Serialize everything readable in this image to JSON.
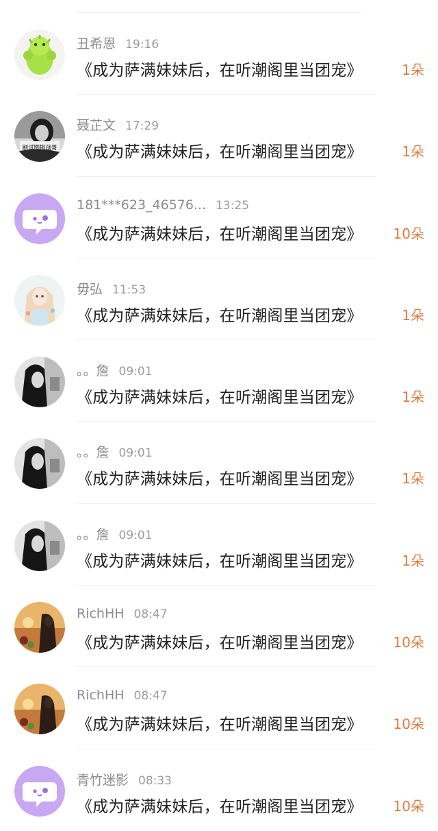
{
  "colors": {
    "accent": "#e07a3c",
    "name": "#8c8c8c",
    "time": "#9c9c9c",
    "title": "#222222",
    "divider": "#efefef",
    "default_avatar": "#c9a8f3"
  },
  "records": [
    {
      "name": "丑希恩",
      "time": "19:16",
      "title": "《成为萨满妹妹后，在听潮阁里当团宠》",
      "count": "1朵",
      "avatar": "green-figure-avatar"
    },
    {
      "name": "聂芷文",
      "time": "17:29",
      "title": "《成为萨满妹妹后，在听潮阁里当团宠》",
      "count": "1朵",
      "avatar": "bw-photo-avatar",
      "avatar_caption": "刷试图挑战哥"
    },
    {
      "name": "181***623_46576...",
      "time": "13:25",
      "title": "《成为萨满妹妹后，在听潮阁里当团宠》",
      "count": "10朵",
      "avatar": "default-chat-avatar"
    },
    {
      "name": "毋弘",
      "time": "11:53",
      "title": "《成为萨满妹妹后，在听潮阁里当团宠》",
      "count": "1朵",
      "avatar": "anime-girl-avatar"
    },
    {
      "name": "。。詹",
      "time": "09:01",
      "title": "《成为萨满妹妹后，在听潮阁里当团宠》",
      "count": "1朵",
      "avatar": "bw-girl-avatar"
    },
    {
      "name": "。。詹",
      "time": "09:01",
      "title": "《成为萨满妹妹后，在听潮阁里当团宠》",
      "count": "1朵",
      "avatar": "bw-girl-avatar"
    },
    {
      "name": "。。詹",
      "time": "09:01",
      "title": "《成为萨满妹妹后，在听潮阁里当团宠》",
      "count": "1朵",
      "avatar": "bw-girl-avatar"
    },
    {
      "name": "RichHH",
      "time": "08:47",
      "title": "《成为萨满妹妹后，在听潮阁里当团宠》",
      "count": "10朵",
      "avatar": "sunset-girl-avatar"
    },
    {
      "name": "RichHH",
      "time": "08:47",
      "title": "《成为萨满妹妹后，在听潮阁里当团宠》",
      "count": "10朵",
      "avatar": "sunset-girl-avatar"
    },
    {
      "name": "青竹迷影",
      "time": "08:33",
      "title": "《成为萨满妹妹后，在听潮阁里当团宠》",
      "count": "10朵",
      "avatar": "default-chat-avatar"
    }
  ]
}
